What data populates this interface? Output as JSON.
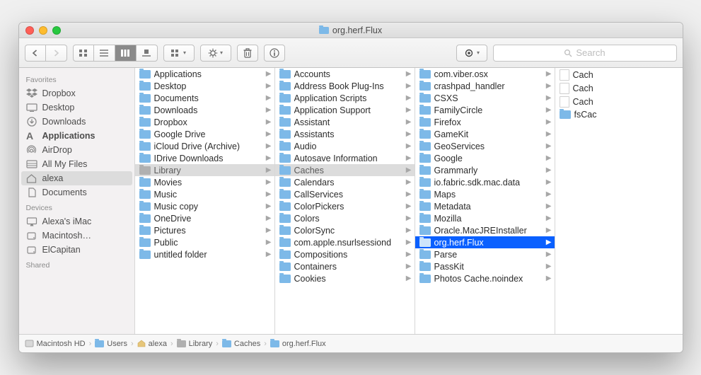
{
  "window_title": "org.herf.Flux",
  "search_placeholder": "Search",
  "sidebar": {
    "sections": [
      {
        "header": "Favorites",
        "items": [
          {
            "icon": "dropbox",
            "label": "Dropbox"
          },
          {
            "icon": "desktop",
            "label": "Desktop"
          },
          {
            "icon": "downloads",
            "label": "Downloads"
          },
          {
            "icon": "apps",
            "label": "Applications",
            "bold": true
          },
          {
            "icon": "airdrop",
            "label": "AirDrop"
          },
          {
            "icon": "allfiles",
            "label": "All My Files"
          },
          {
            "icon": "home",
            "label": "alexa",
            "selected": true
          },
          {
            "icon": "docs",
            "label": "Documents"
          }
        ]
      },
      {
        "header": "Devices",
        "items": [
          {
            "icon": "imac",
            "label": "Alexa's iMac"
          },
          {
            "icon": "hdd",
            "label": "Macintosh…"
          },
          {
            "icon": "hdd",
            "label": "ElCapitan"
          }
        ]
      },
      {
        "header": "Shared",
        "items": []
      }
    ]
  },
  "columns": [
    {
      "selectedIndex": 7,
      "selectedStyle": "grey",
      "items": [
        {
          "label": "Applications",
          "hasChildren": true,
          "iconType": "folder"
        },
        {
          "label": "Desktop",
          "hasChildren": true,
          "iconType": "folder"
        },
        {
          "label": "Documents",
          "hasChildren": true,
          "iconType": "folder"
        },
        {
          "label": "Downloads",
          "hasChildren": true,
          "iconType": "folder"
        },
        {
          "label": "Dropbox",
          "hasChildren": true,
          "iconType": "folder"
        },
        {
          "label": "Google Drive",
          "hasChildren": true,
          "iconType": "folder"
        },
        {
          "label": "iCloud Drive (Archive)",
          "hasChildren": true,
          "iconType": "folder"
        },
        {
          "label": "IDrive Downloads",
          "hasChildren": true,
          "iconType": "folder"
        },
        {
          "label": "Library",
          "hasChildren": true,
          "iconType": "lib"
        },
        {
          "label": "Movies",
          "hasChildren": true,
          "iconType": "folder"
        },
        {
          "label": "Music",
          "hasChildren": true,
          "iconType": "folder"
        },
        {
          "label": "Music copy",
          "hasChildren": true,
          "iconType": "folder"
        },
        {
          "label": "OneDrive",
          "hasChildren": true,
          "iconType": "folder"
        },
        {
          "label": "Pictures",
          "hasChildren": true,
          "iconType": "folder"
        },
        {
          "label": "Public",
          "hasChildren": true,
          "iconType": "folder"
        },
        {
          "label": "untitled folder",
          "hasChildren": true,
          "iconType": "folder"
        }
      ]
    },
    {
      "selectedIndex": 7,
      "selectedStyle": "grey",
      "items": [
        {
          "label": "Accounts",
          "hasChildren": true,
          "iconType": "folder"
        },
        {
          "label": "Address Book Plug-Ins",
          "hasChildren": true,
          "iconType": "folder"
        },
        {
          "label": "Application Scripts",
          "hasChildren": true,
          "iconType": "folder"
        },
        {
          "label": "Application Support",
          "hasChildren": true,
          "iconType": "folder"
        },
        {
          "label": "Assistant",
          "hasChildren": true,
          "iconType": "folder"
        },
        {
          "label": "Assistants",
          "hasChildren": true,
          "iconType": "folder"
        },
        {
          "label": "Audio",
          "hasChildren": true,
          "iconType": "folder"
        },
        {
          "label": "Autosave Information",
          "hasChildren": true,
          "iconType": "folder"
        },
        {
          "label": "Caches",
          "hasChildren": true,
          "iconType": "folder"
        },
        {
          "label": "Calendars",
          "hasChildren": true,
          "iconType": "folder"
        },
        {
          "label": "CallServices",
          "hasChildren": true,
          "iconType": "folder"
        },
        {
          "label": "ColorPickers",
          "hasChildren": true,
          "iconType": "folder"
        },
        {
          "label": "Colors",
          "hasChildren": true,
          "iconType": "folder"
        },
        {
          "label": "ColorSync",
          "hasChildren": true,
          "iconType": "folder"
        },
        {
          "label": "com.apple.nsurlsessiond",
          "hasChildren": true,
          "iconType": "folder"
        },
        {
          "label": "Compositions",
          "hasChildren": true,
          "iconType": "folder"
        },
        {
          "label": "Containers",
          "hasChildren": true,
          "iconType": "folder"
        },
        {
          "label": "Cookies",
          "hasChildren": true,
          "iconType": "folder"
        }
      ]
    },
    {
      "selectedIndex": 13,
      "selectedStyle": "blue",
      "items": [
        {
          "label": "com.viber.osx",
          "hasChildren": true,
          "iconType": "folder"
        },
        {
          "label": "crashpad_handler",
          "hasChildren": true,
          "iconType": "folder"
        },
        {
          "label": "CSXS",
          "hasChildren": true,
          "iconType": "folder"
        },
        {
          "label": "FamilyCircle",
          "hasChildren": true,
          "iconType": "folder"
        },
        {
          "label": "Firefox",
          "hasChildren": true,
          "iconType": "folder"
        },
        {
          "label": "GameKit",
          "hasChildren": true,
          "iconType": "folder"
        },
        {
          "label": "GeoServices",
          "hasChildren": true,
          "iconType": "folder"
        },
        {
          "label": "Google",
          "hasChildren": true,
          "iconType": "folder"
        },
        {
          "label": "Grammarly",
          "hasChildren": true,
          "iconType": "folder"
        },
        {
          "label": "io.fabric.sdk.mac.data",
          "hasChildren": true,
          "iconType": "folder"
        },
        {
          "label": "Maps",
          "hasChildren": true,
          "iconType": "folder"
        },
        {
          "label": "Metadata",
          "hasChildren": true,
          "iconType": "folder"
        },
        {
          "label": "Mozilla",
          "hasChildren": true,
          "iconType": "folder"
        },
        {
          "label": "Oracle.MacJREInstaller",
          "hasChildren": true,
          "iconType": "folder"
        },
        {
          "label": "org.herf.Flux",
          "hasChildren": true,
          "iconType": "folder"
        },
        {
          "label": "Parse",
          "hasChildren": true,
          "iconType": "folder"
        },
        {
          "label": "PassKit",
          "hasChildren": true,
          "iconType": "folder"
        },
        {
          "label": "Photos Cache.noindex",
          "hasChildren": true,
          "iconType": "folder"
        }
      ]
    },
    {
      "selectedIndex": -1,
      "items": [
        {
          "label": "Cach",
          "hasChildren": false,
          "iconType": "file"
        },
        {
          "label": "Cach",
          "hasChildren": false,
          "iconType": "file"
        },
        {
          "label": "Cach",
          "hasChildren": false,
          "iconType": "file"
        },
        {
          "label": "fsCac",
          "hasChildren": false,
          "iconType": "folder"
        }
      ]
    }
  ],
  "pathbar": [
    "Macintosh HD",
    "Users",
    "alexa",
    "Library",
    "Caches",
    "org.herf.Flux"
  ]
}
